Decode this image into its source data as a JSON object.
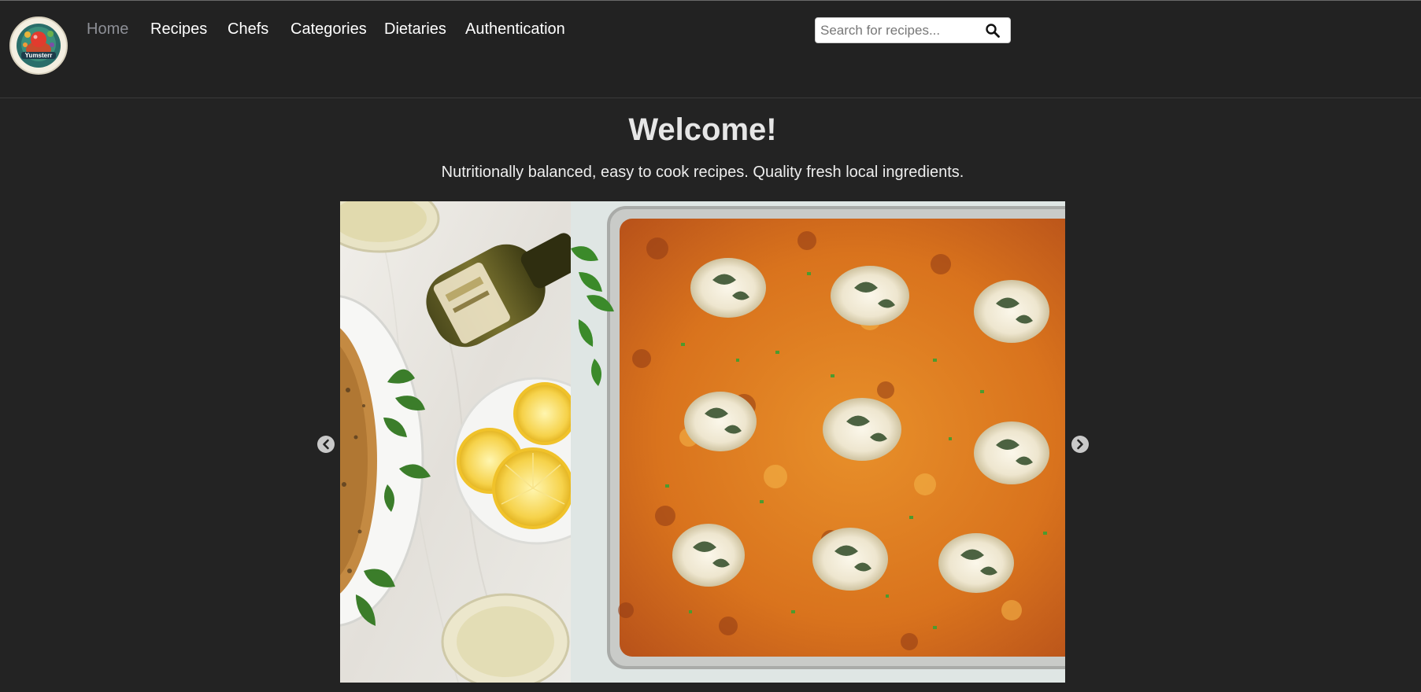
{
  "brand": {
    "logo_text": "Yumsterr"
  },
  "nav": {
    "items": [
      {
        "label": "Home",
        "active": true
      },
      {
        "label": "Recipes",
        "active": false
      },
      {
        "label": "Chefs",
        "active": false
      },
      {
        "label": "Categories",
        "active": false
      },
      {
        "label": "Dietaries",
        "active": false
      },
      {
        "label": "Authentication",
        "active": false
      }
    ]
  },
  "search": {
    "placeholder": "Search for recipes...",
    "value": "",
    "icon": "search-icon"
  },
  "hero": {
    "title": "Welcome!",
    "tagline": "Nutritionally balanced, easy to cook recipes. Quality fresh local ingredients."
  },
  "carousel": {
    "prev_icon": "chevron-left-icon",
    "next_icon": "chevron-right-icon"
  },
  "colors": {
    "background": "#232323",
    "nav_active": "#8d8f96",
    "nav_text": "#ffffff"
  }
}
